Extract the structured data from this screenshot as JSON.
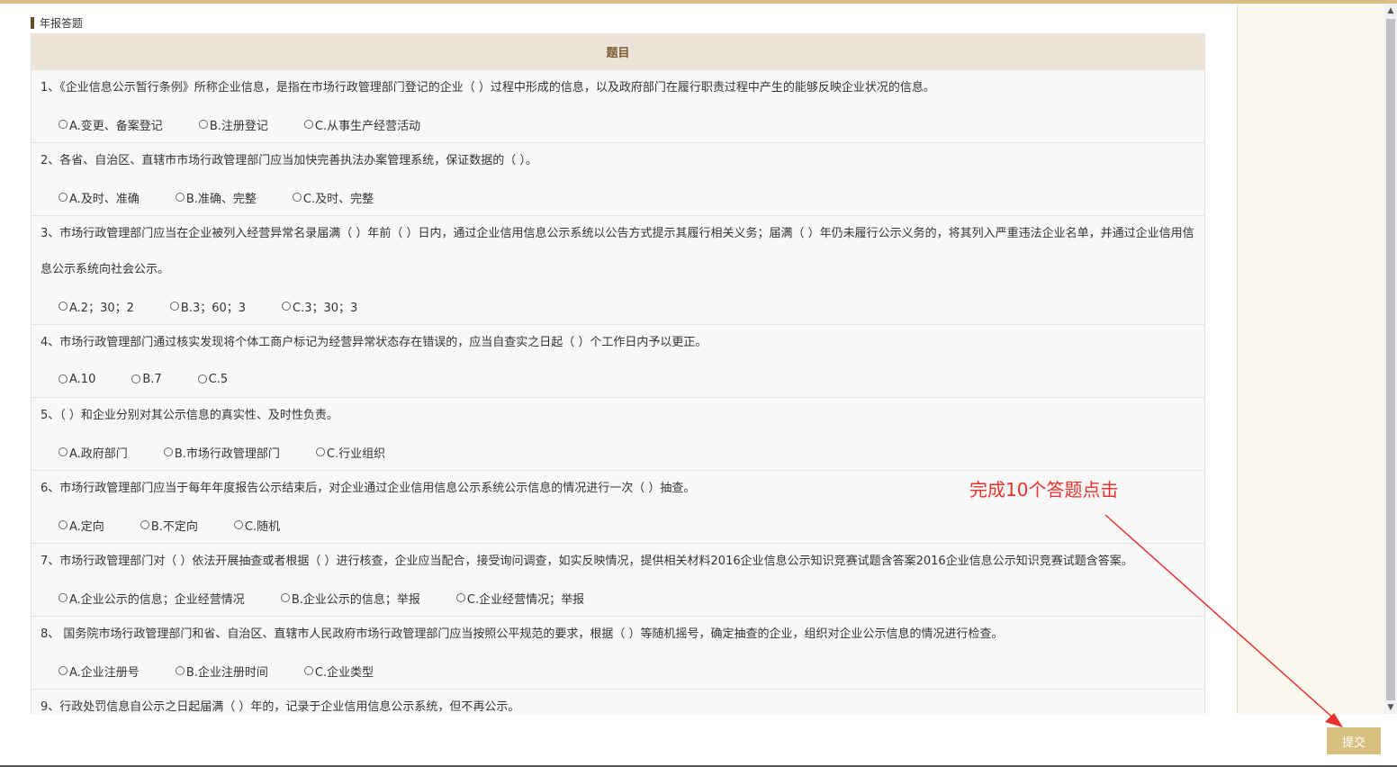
{
  "section_title": "年报答题",
  "quiz": {
    "header": "题目",
    "questions": [
      {
        "text": "1、《企业信息公示暂行条例》所称企业信息，是指在市场行政管理部门登记的企业（ ）过程中形成的信息，以及政府部门在履行职责过程中产生的能够反映企业状况的信息。",
        "options": [
          "A.变更、备案登记",
          "B.注册登记",
          "C.从事生产经营活动"
        ]
      },
      {
        "text": "2、各省、自治区、直辖市市场行政管理部门应当加快完善执法办案管理系统，保证数据的（ ）。",
        "options": [
          "A.及时、准确",
          "B.准确、完整",
          "C.及时、完整"
        ]
      },
      {
        "text": "3、市场行政管理部门应当在企业被列入经营异常名录届满（ ）年前（ ）日内，通过企业信用信息公示系统以公告方式提示其履行相关义务；届满（ ）年仍未履行公示义务的，将其列入严重违法企业名单，并通过企业信用信息公示系统向社会公示。",
        "options": [
          "A.2；30；2",
          "B.3；60；3",
          "C.3；30；3"
        ]
      },
      {
        "text": "4、市场行政管理部门通过核实发现将个体工商户标记为经营异常状态存在错误的，应当自查实之日起（ ）个工作日内予以更正。",
        "options": [
          "A.10",
          "B.7",
          "C.5"
        ]
      },
      {
        "text": "5、（ ）和企业分别对其公示信息的真实性、及时性负责。",
        "options": [
          "A.政府部门",
          "B.市场行政管理部门",
          "C.行业组织"
        ]
      },
      {
        "text": "6、市场行政管理部门应当于每年年度报告公示结束后，对企业通过企业信用信息公示系统公示信息的情况进行一次（ ）抽查。",
        "options": [
          "A.定向",
          "B.不定向",
          "C.随机"
        ]
      },
      {
        "text": "7、市场行政管理部门对（ ）依法开展抽查或者根据（ ）进行核查，企业应当配合，接受询问调查，如实反映情况，提供相关材料2016企业信息公示知识竞赛试题含答案2016企业信息公示知识竞赛试题含答案。",
        "options": [
          "A.企业公示的信息；企业经营情况",
          "B.企业公示的信息；举报",
          "C.企业经营情况；举报"
        ]
      },
      {
        "text": "8、 国务院市场行政管理部门和省、自治区、直辖市人民政府市场行政管理部门应当按照公平规范的要求，根据（ ）等随机摇号，确定抽查的企业，组织对企业公示信息的情况进行检查。",
        "options": [
          "A.企业注册号",
          "B.企业注册时间",
          "C.企业类型"
        ]
      },
      {
        "text": "9、行政处罚信息自公示之日起届满（ ）年的，记录于企业信用信息公示系统，但不再公示。",
        "options": []
      }
    ]
  },
  "annotation": "完成10个答题点击",
  "submit_label": "提交",
  "colors": {
    "accent": "#d6bf7f",
    "header_bg": "#ece3d9",
    "header_text": "#7b5a33",
    "annotation": "#e8322b"
  }
}
